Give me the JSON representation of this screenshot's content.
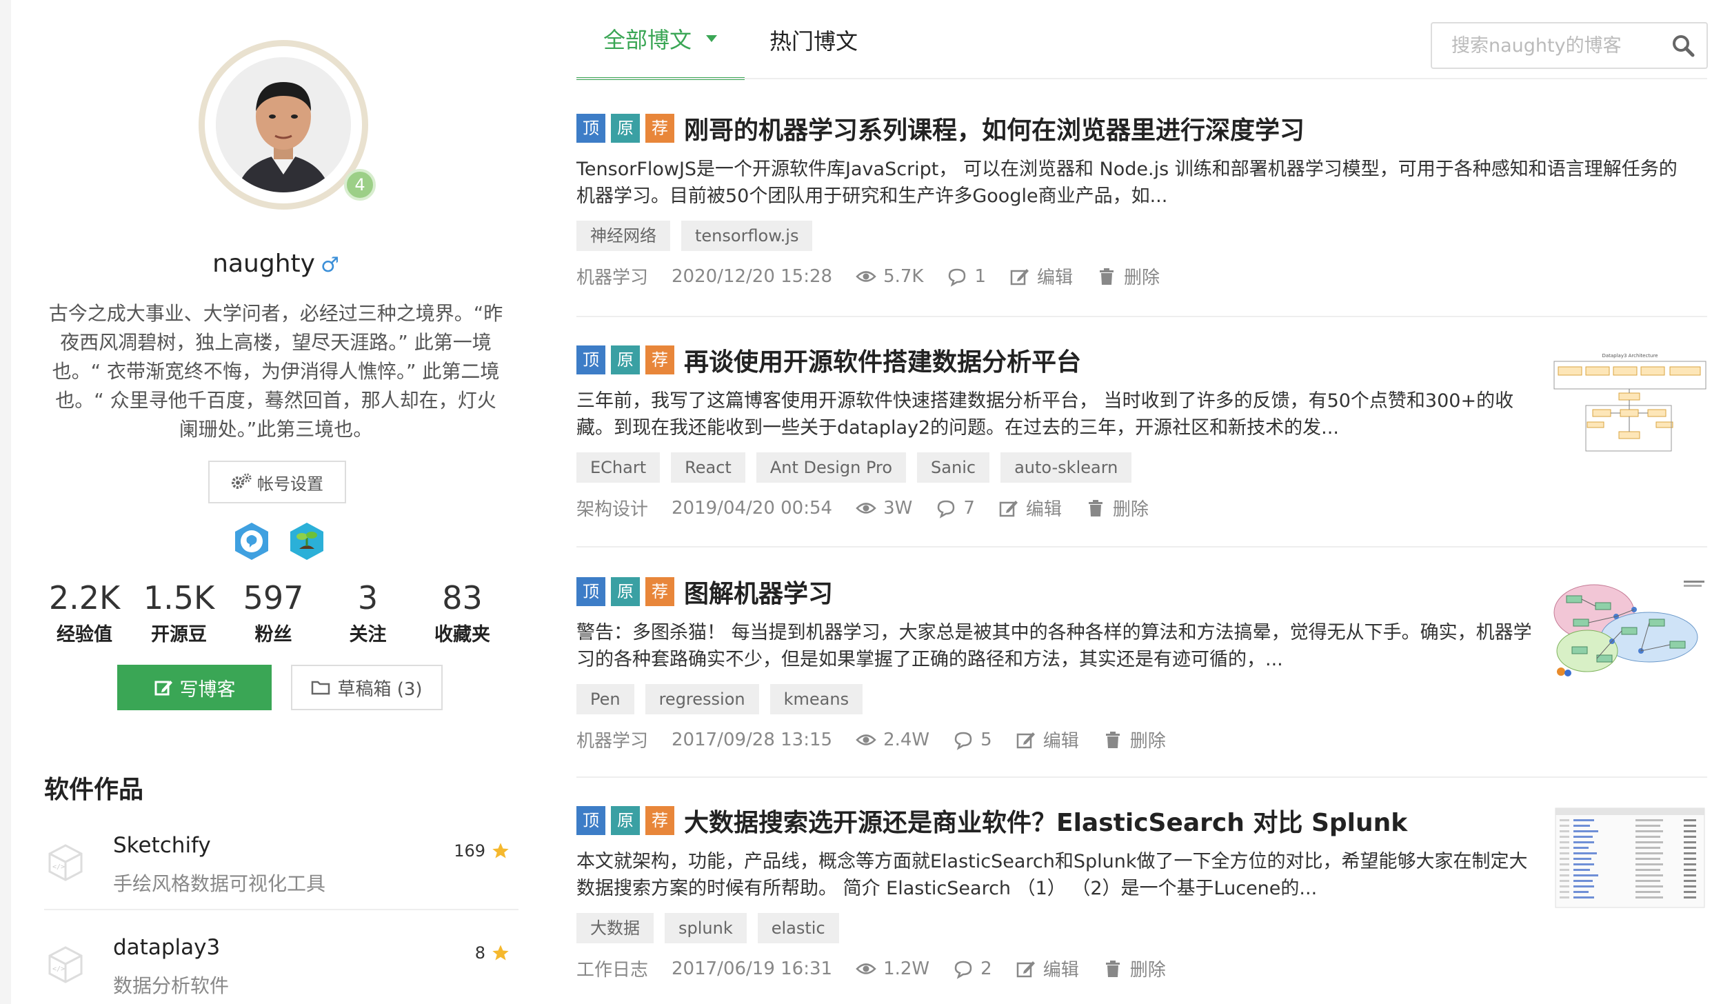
{
  "tabs": {
    "all": "全部博文",
    "hot": "热门博文"
  },
  "search": {
    "placeholder": "搜索naughty的博客"
  },
  "profile": {
    "level": "4",
    "username": "naughty",
    "gender_icon": "♂",
    "bio": "古今之成大事业、大学问者，必经过三种之境界。“昨夜西风凋碧树，独上高楼，望尽天涯路。” 此第一境也。“ 衣带渐宽终不悔，为伊消得人憔悴。” 此第二境也。“ 众里寻他千百度，蓦然回首，那人却在，灯火阑珊处。”此第三境也。",
    "account_settings": "帐号设置",
    "stats": [
      {
        "value": "2.2K",
        "label": "经验值"
      },
      {
        "value": "1.5K",
        "label": "开源豆"
      },
      {
        "value": "597",
        "label": "粉丝"
      },
      {
        "value": "3",
        "label": "关注"
      },
      {
        "value": "83",
        "label": "收藏夹"
      }
    ],
    "write_blog": "写博客",
    "drafts": "草稿箱 (3)"
  },
  "software": {
    "title": "软件作品",
    "items": [
      {
        "name": "Sketchify",
        "desc": "手绘风格数据可视化工具",
        "stars": "169"
      },
      {
        "name": "dataplay3",
        "desc": "数据分析软件",
        "stars": "8"
      }
    ]
  },
  "posts": [
    {
      "badges": [
        "顶",
        "原",
        "荐"
      ],
      "title": "刚哥的机器学习系列课程，如何在浏览器里进行深度学习",
      "summary": "TensorFlowJS是一个开源软件库JavaScript， 可以在浏览器和 Node.js 训练和部署机器学习模型，可用于各种感知和语言理解任务的机器学习。目前被50个团队用于研究和生产许多Google商业产品，如...",
      "tags": [
        "神经网络",
        "tensorflow.js"
      ],
      "category": "机器学习",
      "date": "2020/12/20 15:28",
      "views": "5.7K",
      "comments": "1",
      "edit": "编辑",
      "delete": "删除",
      "has_thumb": false
    },
    {
      "badges": [
        "顶",
        "原",
        "荐"
      ],
      "title": "再谈使用开源软件搭建数据分析平台",
      "summary": "三年前，我写了这篇博客使用开源软件快速搭建数据分析平台， 当时收到了许多的反馈，有50个点赞和300+的收藏。到现在我还能收到一些关于dataplay2的问题。在过去的三年，开源社区和新技术的发...",
      "tags": [
        "EChart",
        "React",
        "Ant Design Pro",
        "Sanic",
        "auto-sklearn"
      ],
      "category": "架构设计",
      "date": "2019/04/20 00:54",
      "views": "3W",
      "comments": "7",
      "edit": "编辑",
      "delete": "删除",
      "has_thumb": true,
      "thumb_caption": "Dataplay3 Architecture"
    },
    {
      "badges": [
        "顶",
        "原",
        "荐"
      ],
      "title": "图解机器学习",
      "summary": "警告：多图杀猫！ 每当提到机器学习，大家总是被其中的各种各样的算法和方法搞晕，觉得无从下手。确实，机器学习的各种套路确实不少，但是如果掌握了正确的路径和方法，其实还是有迹可循的，...",
      "tags": [
        "Pen",
        "regression",
        "kmeans"
      ],
      "category": "机器学习",
      "date": "2017/09/28 13:15",
      "views": "2.4W",
      "comments": "5",
      "edit": "编辑",
      "delete": "删除",
      "has_thumb": true
    },
    {
      "badges": [
        "顶",
        "原",
        "荐"
      ],
      "title": "大数据搜索选开源还是商业软件？ElasticSearch 对比 Splunk",
      "summary": "本文就架构，功能，产品线，概念等方面就ElasticSearch和Splunk做了一下全方位的对比，希望能够大家在制定大数据搜索方案的时候有所帮助。 简介 ElasticSearch （1） （2）是一个基于Lucene的...",
      "tags": [
        "大数据",
        "splunk",
        "elastic"
      ],
      "category": "工作日志",
      "date": "2017/06/19 16:31",
      "views": "1.2W",
      "comments": "2",
      "edit": "编辑",
      "delete": "删除",
      "has_thumb": true
    }
  ],
  "colors": {
    "accent": "#3aa655",
    "top_badge": "#3d7dc7",
    "orig_badge": "#3aa0a3",
    "rec_badge": "#e8863a",
    "star": "#f5b82e"
  }
}
